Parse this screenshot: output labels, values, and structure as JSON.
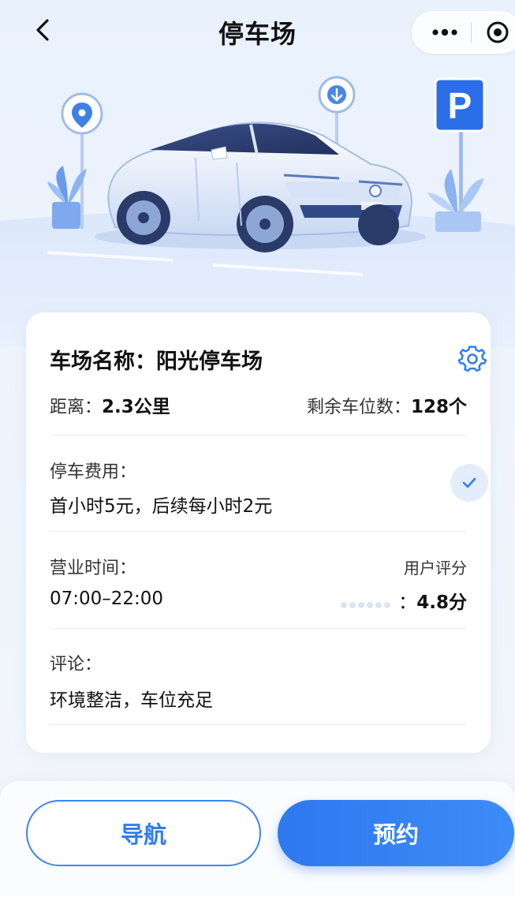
{
  "nav": {
    "title": "停车场"
  },
  "parking": {
    "name_label": "车场名称：",
    "name_value": "阳光停车场",
    "distance_label": "距离：",
    "distance_value": "2.3公里",
    "spots_label": "剩余车位数：",
    "spots_value": "128个",
    "fee_label": "停车费用：",
    "fee_value": "首小时5元，后续每小时2元",
    "hours_label": "营业时间：",
    "hours_value": "07:00–22:00",
    "rating_label": "用户评分",
    "rating_prefix": "：",
    "rating_value": "4.8分",
    "comment_label": "评论：",
    "comment_value": "环境整洁，车位充足"
  },
  "hero": {
    "sign_letter": "P"
  },
  "actions": {
    "navigate_label": "导航",
    "book_label": "预约"
  },
  "colors": {
    "accent": "#2f7df0",
    "accent_light": "#e4edfb",
    "background": "#eaf1fd"
  },
  "icons": [
    "back-icon",
    "more-icon",
    "target-icon",
    "location-pin-icon",
    "download-pin-icon",
    "parking-sign-icon",
    "gear-icon",
    "check-icon"
  ]
}
